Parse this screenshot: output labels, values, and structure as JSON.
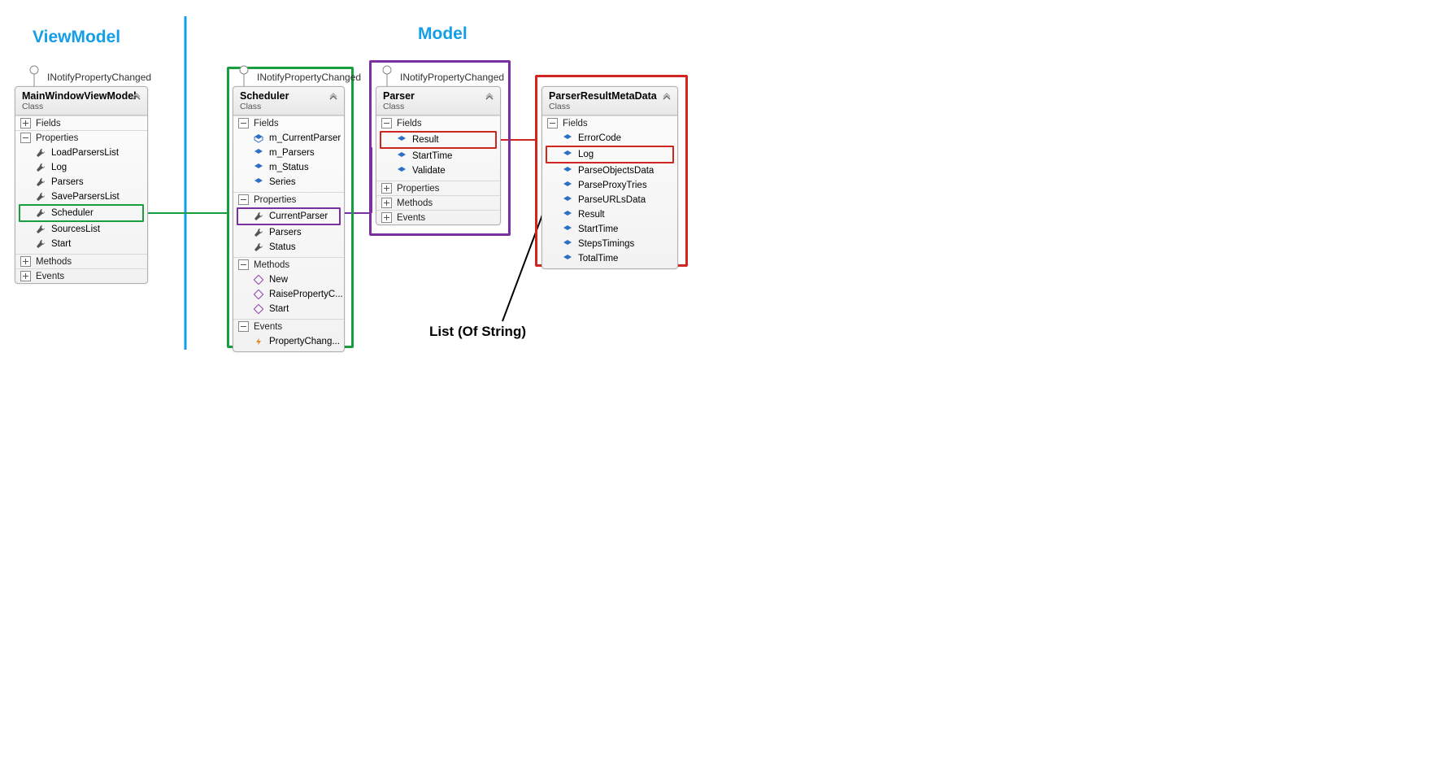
{
  "labels": {
    "viewmodel": "ViewModel",
    "model": "Model",
    "annotation": "List (Of String)"
  },
  "sections": {
    "fields": "Fields",
    "properties": "Properties",
    "methods": "Methods",
    "events": "Events"
  },
  "interface_label": "INotifyPropertyChanged",
  "classes": {
    "vm": {
      "name": "MainWindowViewModel",
      "sub": "Class",
      "properties": [
        "LoadParsersList",
        "Log",
        "Parsers",
        "SaveParsersList",
        "Scheduler",
        "SourcesList",
        "Start"
      ]
    },
    "scheduler": {
      "name": "Scheduler",
      "sub": "Class",
      "fields": [
        "m_CurrentParser",
        "m_Parsers",
        "m_Status",
        "Series"
      ],
      "properties": [
        "CurrentParser",
        "Parsers",
        "Status"
      ],
      "methods": [
        "New",
        "RaisePropertyC...",
        "Start"
      ],
      "events": [
        "PropertyChang..."
      ]
    },
    "parser": {
      "name": "Parser",
      "sub": "Class",
      "fields": [
        "Result",
        "StartTime",
        "Validate"
      ]
    },
    "meta": {
      "name": "ParserResultMetaData",
      "sub": "Class",
      "fields": [
        "ErrorCode",
        "Log",
        "ParseObjectsData",
        "ParseProxyTries",
        "ParseURLsData",
        "Result",
        "StartTime",
        "StepsTimings",
        "TotalTime"
      ]
    }
  }
}
